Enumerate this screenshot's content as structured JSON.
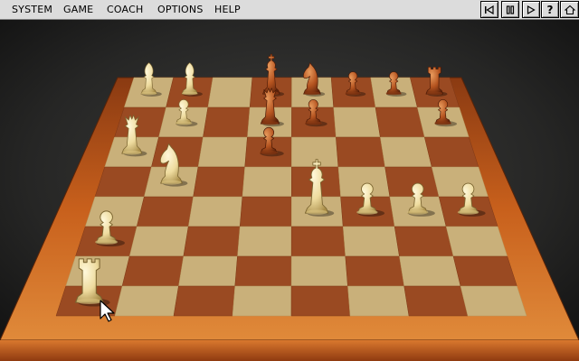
{
  "menu": {
    "items": [
      {
        "id": "system",
        "label": "SYSTEM"
      },
      {
        "id": "game",
        "label": "GAME"
      },
      {
        "id": "coach",
        "label": "COACH"
      },
      {
        "id": "options",
        "label": "OPTIONS"
      },
      {
        "id": "help",
        "label": "HELP"
      }
    ]
  },
  "toolbar": {
    "buttons": [
      {
        "id": "rewind",
        "icon": "rewind-icon"
      },
      {
        "id": "pause",
        "icon": "pause-icon"
      },
      {
        "id": "play",
        "icon": "play-icon"
      },
      {
        "id": "help",
        "icon": "question-icon",
        "label": "?"
      },
      {
        "id": "home",
        "icon": "home-icon"
      }
    ]
  },
  "colors": {
    "menubar": "#dcdcdc",
    "light_square": "#c9b07a",
    "dark_square": "#9a4a22",
    "board_frame": "#c8601c",
    "white_pieces": "#eedb9e",
    "black_pieces": "#b4531f"
  },
  "board": {
    "pieces": [
      {
        "color": "white",
        "type": "bishop",
        "square": "a8"
      },
      {
        "color": "white",
        "type": "bishop",
        "square": "b8"
      },
      {
        "color": "white",
        "type": "pawn",
        "square": "b7"
      },
      {
        "color": "white",
        "type": "queen",
        "square": "a6"
      },
      {
        "color": "white",
        "type": "knight",
        "square": "b5"
      },
      {
        "color": "white",
        "type": "pawn",
        "square": "a3"
      },
      {
        "color": "white",
        "type": "rook",
        "square": "a1"
      },
      {
        "color": "white",
        "type": "king",
        "square": "e4"
      },
      {
        "color": "white",
        "type": "pawn",
        "square": "f4"
      },
      {
        "color": "white",
        "type": "pawn",
        "square": "g4"
      },
      {
        "color": "white",
        "type": "pawn",
        "square": "h4"
      },
      {
        "color": "black",
        "type": "king",
        "square": "d8"
      },
      {
        "color": "black",
        "type": "knight",
        "square": "e8"
      },
      {
        "color": "black",
        "type": "pawn",
        "square": "e7"
      },
      {
        "color": "black",
        "type": "pawn",
        "square": "f8"
      },
      {
        "color": "black",
        "type": "pawn",
        "square": "g8"
      },
      {
        "color": "black",
        "type": "rook",
        "square": "h8"
      },
      {
        "color": "black",
        "type": "pawn",
        "square": "h7"
      },
      {
        "color": "black",
        "type": "queen",
        "square": "d7"
      },
      {
        "color": "black",
        "type": "pawn",
        "square": "d6"
      }
    ]
  },
  "cursor": {
    "icon": "arrow-cursor-icon"
  }
}
